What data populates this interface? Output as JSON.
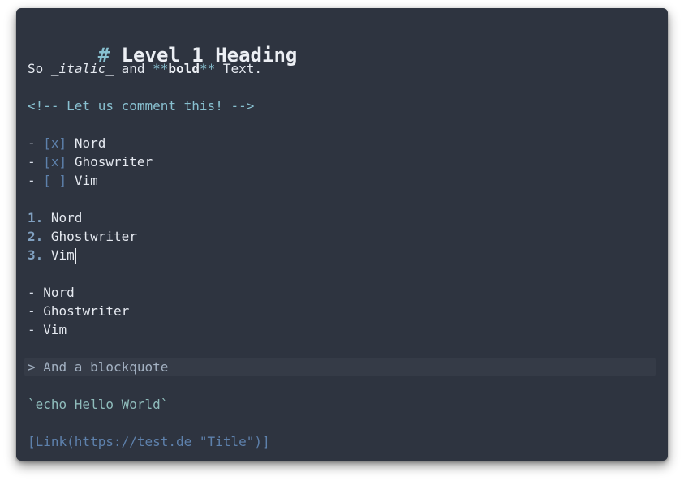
{
  "heading": {
    "hash": "#",
    "text": "Level 1 Heading"
  },
  "paragraph": {
    "prefix": "So ",
    "italic_mark_open": "_",
    "italic_text": "italic",
    "italic_mark_close": "_",
    "middle": " and ",
    "bold_mark_open": "**",
    "bold_text": "bold",
    "bold_mark_close": "**",
    "suffix": " Text."
  },
  "comment": "<!-- Let us comment this! -->",
  "task_list": [
    {
      "bullet": "-",
      "box": "[x]",
      "text": "Nord"
    },
    {
      "bullet": "-",
      "box": "[x]",
      "text": "Ghoswriter"
    },
    {
      "bullet": "-",
      "box": "[ ]",
      "text": "Vim"
    }
  ],
  "ordered_list": [
    {
      "num": "1.",
      "text": "Nord"
    },
    {
      "num": "2.",
      "text": "Ghostwriter"
    },
    {
      "num": "3.",
      "text": "Vim"
    }
  ],
  "bullet_list": [
    {
      "bullet": "-",
      "text": "Nord"
    },
    {
      "bullet": "-",
      "text": "Ghostwriter"
    },
    {
      "bullet": "-",
      "text": "Vim"
    }
  ],
  "blockquote": "> And a blockquote",
  "inline_code": "`echo Hello World`",
  "link": "[Link(https://test.de \"Title\")]",
  "colors": {
    "background": "#2e3440",
    "text": "#e5e9f0",
    "accent": "#88c0d0",
    "task_marker": "#5e81ac",
    "list_number": "#81a1c1",
    "code": "#8fbcbb",
    "link": "#5e81ac"
  }
}
